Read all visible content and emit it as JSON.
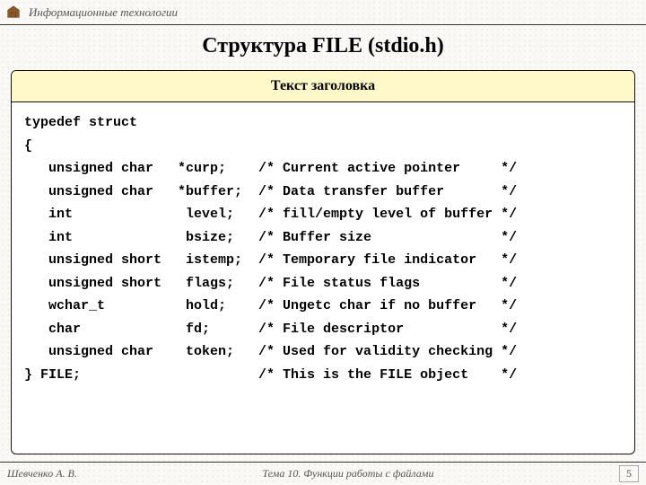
{
  "course": "Информационные технологии",
  "page_title": "Структура FILE (stdio.h)",
  "box_header": "Текст заголовка",
  "code": {
    "open1": "typedef struct",
    "open2": "{",
    "fields": [
      {
        "type": "unsigned char",
        "name": "*curp;",
        "comment": "Current active pointer"
      },
      {
        "type": "unsigned char",
        "name": "*buffer;",
        "comment": "Data transfer buffer"
      },
      {
        "type": "int",
        "name": " level;",
        "comment": "fill/empty level of buffer"
      },
      {
        "type": "int",
        "name": " bsize;",
        "comment": "Buffer size"
      },
      {
        "type": "unsigned short",
        "name": " istemp;",
        "comment": "Temporary file indicator"
      },
      {
        "type": "unsigned short",
        "name": " flags;",
        "comment": "File status flags"
      },
      {
        "type": "wchar_t",
        "name": " hold;",
        "comment": "Ungetc char if no buffer"
      },
      {
        "type": "char",
        "name": " fd;",
        "comment": "File descriptor"
      },
      {
        "type": "unsigned char",
        "name": " token;",
        "comment": "Used for validity checking"
      }
    ],
    "close": "} FILE;",
    "close_comment": "This is the FILE object"
  },
  "footer": {
    "author": "Шевченко А. В.",
    "topic": "Тема 10. Функции работы с файлами",
    "page_number": "5"
  },
  "layout": {
    "type_w": 16,
    "name_w": 10,
    "cmt_w": 27
  }
}
